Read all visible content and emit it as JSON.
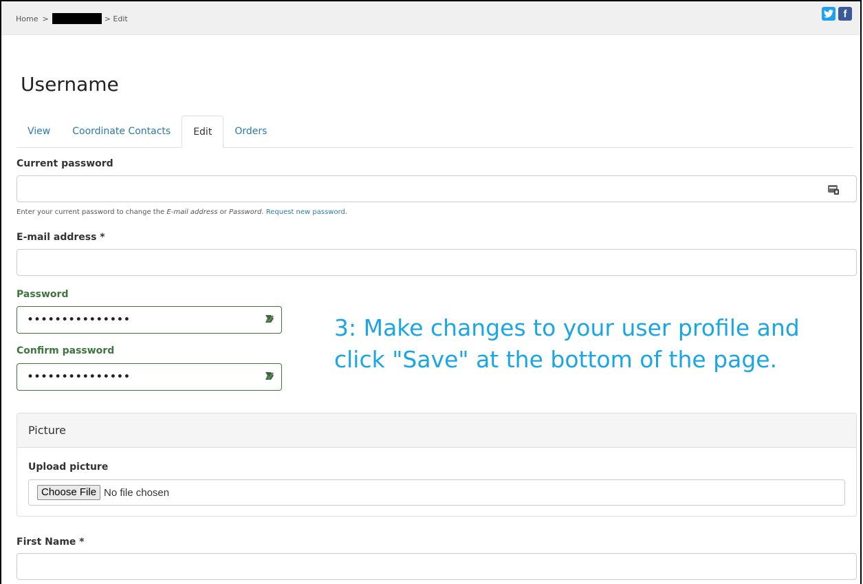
{
  "breadcrumb": {
    "home": "Home",
    "sep1": ">",
    "current": "> Edit"
  },
  "social": {
    "twitter_icon": "twitter-icon",
    "facebook_icon": "facebook-icon",
    "twitter_glyph": "🐦",
    "facebook_glyph": "f"
  },
  "page": {
    "title": "Username"
  },
  "tabs": [
    {
      "label": "View"
    },
    {
      "label": "Coordinate Contacts"
    },
    {
      "label": "Edit"
    },
    {
      "label": "Orders"
    }
  ],
  "form": {
    "current_password_label": "Current password",
    "current_password_value": "",
    "help_prefix": "Enter your current password to change the ",
    "help_email": "E-mail address",
    "help_or": " or ",
    "help_password": "Password",
    "help_dot": ". ",
    "help_link": "Request new password",
    "help_end": ".",
    "email_label": "E-mail address *",
    "email_value": "",
    "password_label": "Password",
    "password_value": "•••••••••••••••",
    "confirm_label": "Confirm password",
    "confirm_value": "•••••••••••••••",
    "first_name_label": "First Name *",
    "first_name_value": ""
  },
  "callout": {
    "line1": "3: Make changes to your user profile and",
    "line2": "click \"Save\" at the bottom of the page."
  },
  "picture": {
    "heading": "Picture",
    "upload_label": "Upload picture",
    "choose_button": "Choose File",
    "no_file": "No file chosen"
  },
  "colors": {
    "link": "#2a7ab0",
    "valid": "#3c763d",
    "callout": "#1aa6e4",
    "twitter": "#1da1f2",
    "facebook": "#3b5998"
  }
}
